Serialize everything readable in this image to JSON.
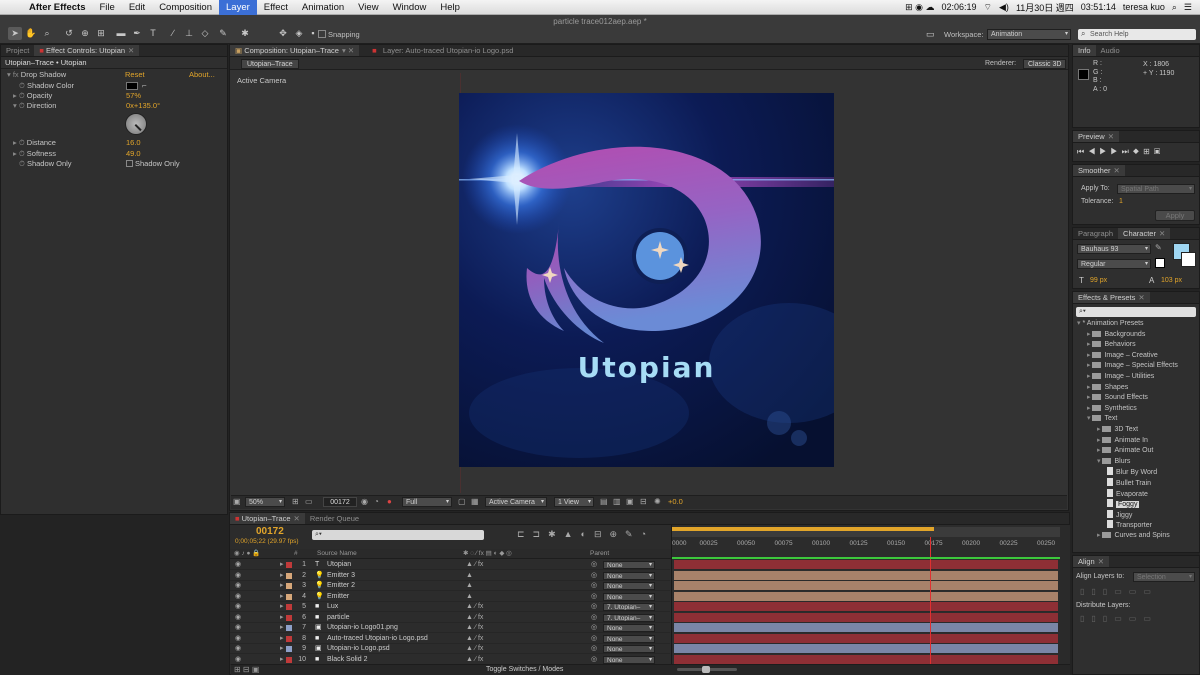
{
  "menubar": {
    "app_name": "After Effects",
    "items": [
      "File",
      "Edit",
      "Composition",
      "Layer",
      "Effect",
      "Animation",
      "View",
      "Window",
      "Help"
    ],
    "selected": "Layer",
    "status_time_small": "02:06:19",
    "date": "11月30日 週四",
    "clock": "03:51:14",
    "user": "teresa kuo"
  },
  "document_title": "particle trace012aep.aep *",
  "toolbar": {
    "snapping_label": "Snapping",
    "workspace_label": "Workspace:",
    "workspace_value": "Animation",
    "search_placeholder": "Search Help"
  },
  "left_panel": {
    "tabs": [
      "Project",
      "Effect Controls: Utopian"
    ],
    "header": "Utopian–Trace • Utopian",
    "effect_name": "Drop Shadow",
    "reset_label": "Reset",
    "about_label": "About...",
    "props": [
      {
        "label": "Shadow Color",
        "value": ""
      },
      {
        "label": "Opacity",
        "value": "57%"
      },
      {
        "label": "Direction",
        "value": "0x+135.0°"
      },
      {
        "label": "Distance",
        "value": "16.0"
      },
      {
        "label": "Softness",
        "value": "49.0"
      },
      {
        "label": "Shadow Only",
        "value": "Shadow Only"
      }
    ]
  },
  "comp_panel": {
    "tabs": [
      "Composition: Utopian–Trace",
      "Layer: Auto-traced Utopian-io Logo.psd"
    ],
    "subtab": "Utopian–Trace",
    "renderer_label": "Renderer:",
    "renderer_value": "Classic 3D",
    "camera_label": "Active Camera",
    "logo_text": "Utopian",
    "footer": {
      "zoom": "50%",
      "frame": "00172",
      "resolution": "Full",
      "camera": "Active Camera",
      "views": "1 View",
      "exposure": "+0.0"
    }
  },
  "info_panel": {
    "tabs": [
      "Info",
      "Audio"
    ],
    "r": "R :",
    "g": "G :",
    "b": "B :",
    "a": "A : 0",
    "x": "X : 1806",
    "y": "+ Y : 1190"
  },
  "preview_panel": {
    "tab": "Preview"
  },
  "smoother_panel": {
    "tab": "Smoother",
    "apply_to_label": "Apply To:",
    "apply_to_value": "Spatial Path",
    "tolerance_label": "Tolerance:",
    "tolerance_value": "1",
    "apply_button": "Apply"
  },
  "character_panel": {
    "tabs": [
      "Paragraph",
      "Character"
    ],
    "font": "Bauhaus 93",
    "style": "Regular",
    "size": "99 px",
    "leading": "103 px",
    "fill_color": "#9fd6f2"
  },
  "effects_panel": {
    "tab": "Effects & Presets",
    "items": [
      {
        "label": "* Animation Presets",
        "level": 0,
        "type": "open"
      },
      {
        "label": "Backgrounds",
        "level": 1,
        "type": "folder"
      },
      {
        "label": "Behaviors",
        "level": 1,
        "type": "folder"
      },
      {
        "label": "Image – Creative",
        "level": 1,
        "type": "folder"
      },
      {
        "label": "Image – Special Effects",
        "level": 1,
        "type": "folder"
      },
      {
        "label": "Image – Utilities",
        "level": 1,
        "type": "folder"
      },
      {
        "label": "Shapes",
        "level": 1,
        "type": "folder"
      },
      {
        "label": "Sound Effects",
        "level": 1,
        "type": "folder"
      },
      {
        "label": "Synthetics",
        "level": 1,
        "type": "folder"
      },
      {
        "label": "Text",
        "level": 1,
        "type": "openfolder"
      },
      {
        "label": "3D Text",
        "level": 2,
        "type": "folder"
      },
      {
        "label": "Animate In",
        "level": 2,
        "type": "folder"
      },
      {
        "label": "Animate Out",
        "level": 2,
        "type": "folder"
      },
      {
        "label": "Blurs",
        "level": 2,
        "type": "openfolder"
      },
      {
        "label": "Blur By Word",
        "level": 3,
        "type": "file"
      },
      {
        "label": "Bullet Train",
        "level": 3,
        "type": "file"
      },
      {
        "label": "Evaporate",
        "level": 3,
        "type": "file"
      },
      {
        "label": "Foggy",
        "level": 3,
        "type": "file",
        "selected": true
      },
      {
        "label": "Jiggy",
        "level": 3,
        "type": "file"
      },
      {
        "label": "Transporter",
        "level": 3,
        "type": "file"
      },
      {
        "label": "Curves and Spins",
        "level": 2,
        "type": "folder"
      }
    ]
  },
  "align_panel": {
    "tab": "Align",
    "align_to_label": "Align Layers to:",
    "align_to_value": "Selection",
    "distribute_label": "Distribute Layers:"
  },
  "timeline": {
    "tabs": [
      "Utopian–Trace",
      "Render Queue"
    ],
    "current_frame": "00172",
    "timecode": "0;00;05;22 (29.97 fps)",
    "columns": {
      "num": "#",
      "source": "Source Name",
      "parent": "Parent"
    },
    "ruler": [
      "0000",
      "00025",
      "00050",
      "00075",
      "00100",
      "00125",
      "00150",
      "00175",
      "00200",
      "00225",
      "00250"
    ],
    "playhead_frame": 172,
    "toggle_label": "Toggle Switches / Modes",
    "layers": [
      {
        "num": "1",
        "name": "Utopian",
        "parent": "None",
        "color": "#c03a3a",
        "bar": "#8e2f35",
        "type": "text"
      },
      {
        "num": "2",
        "name": "Emitter 3",
        "parent": "None",
        "color": "#d7a77a",
        "bar": "#a8826a",
        "type": "light"
      },
      {
        "num": "3",
        "name": "Emitter 2",
        "parent": "None",
        "color": "#d7a77a",
        "bar": "#a8826a",
        "type": "light"
      },
      {
        "num": "4",
        "name": "Emitter",
        "parent": "None",
        "color": "#d7a77a",
        "bar": "#a8826a",
        "type": "light"
      },
      {
        "num": "5",
        "name": "Lux",
        "parent": "7. Utopian–",
        "color": "#c03a3a",
        "bar": "#8e2f35",
        "type": "solid"
      },
      {
        "num": "6",
        "name": "particle",
        "parent": "7. Utopian–",
        "color": "#c03a3a",
        "bar": "#8e2f35",
        "type": "solid"
      },
      {
        "num": "7",
        "name": "Utopian-io Logo01.png",
        "parent": "None",
        "color": "#8ea0c8",
        "bar": "#7a86a6",
        "type": "image"
      },
      {
        "num": "8",
        "name": "Auto-traced Utopian-io Logo.psd",
        "parent": "None",
        "color": "#c03a3a",
        "bar": "#8e2f35",
        "type": "solid"
      },
      {
        "num": "9",
        "name": "Utopian-io Logo.psd",
        "parent": "None",
        "color": "#8ea0c8",
        "bar": "#7a86a6",
        "type": "psd"
      },
      {
        "num": "10",
        "name": "Black Solid 2",
        "parent": "None",
        "color": "#c03a3a",
        "bar": "#8e2f35",
        "type": "solid"
      }
    ]
  }
}
